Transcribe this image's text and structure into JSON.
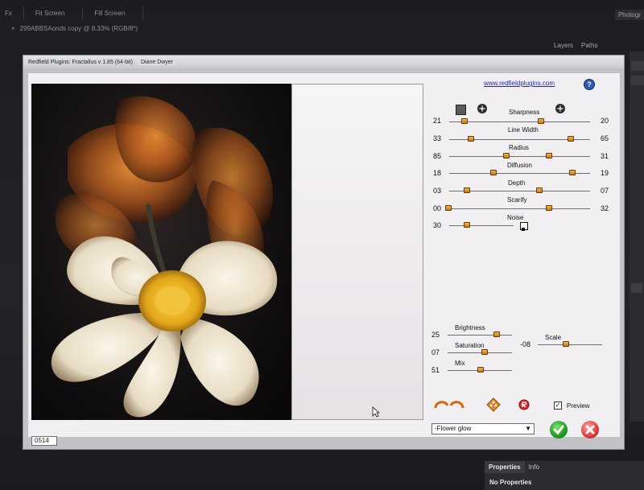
{
  "photoshop": {
    "tabs": [
      "Fx",
      "Fit Screen",
      "Fill Screen"
    ],
    "top_right_label": "Photogr",
    "document_tab": {
      "close": "×",
      "title": "299ABBSAonds copy @ 8.33% (RGB/8*)"
    },
    "panel_tabs": [
      "Layers",
      "Paths"
    ],
    "properties_tabs": [
      "Properties",
      "Info"
    ],
    "properties_message": "No Properties"
  },
  "dialog": {
    "title": "Redfield Plugins: Fractalius v 1.85 (64-bit)",
    "user": "Diane Dwyer",
    "website": "www.redfieldplugins.com",
    "help": "?",
    "status_value": "0514",
    "preset": "-Flower glow",
    "preview_label": "Preview",
    "preview_checked": "✓"
  },
  "sliders": [
    {
      "label": "Sharpness",
      "left_value": "21",
      "right_value": "20"
    },
    {
      "label": "Line Width",
      "left_value": "33",
      "right_value": "65"
    },
    {
      "label": "Radius",
      "left_value": "85",
      "right_value": "31"
    },
    {
      "label": "Diffusion",
      "left_value": "18",
      "right_value": "19"
    },
    {
      "label": "Depth",
      "left_value": "03",
      "right_value": "07"
    },
    {
      "label": "Scarify",
      "left_value": "00",
      "right_value": "32"
    },
    {
      "label": "Noise",
      "left_value": "30",
      "right_value": ""
    }
  ],
  "bottom_sliders": [
    {
      "label": "Brightness",
      "value": "25"
    },
    {
      "label": "Saturation",
      "value": "07"
    },
    {
      "label": "Mix",
      "value": "51"
    }
  ],
  "scale_slider": {
    "label": "Scale",
    "value": "-08"
  },
  "colors": {
    "dialog_bg": "#c2c1c7",
    "slider_thumb": "#e09a2a",
    "ok_green": "#1d9a25",
    "cancel_red": "#e03a3a",
    "link_blue": "#2227b8"
  }
}
